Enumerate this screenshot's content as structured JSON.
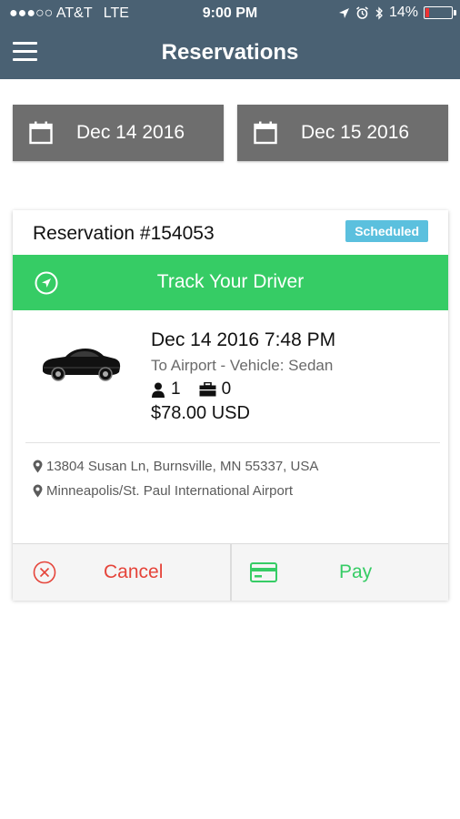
{
  "status_bar": {
    "signal": "●●●○○",
    "carrier": "AT&T",
    "network": "LTE",
    "time": "9:00 PM",
    "battery": "14%"
  },
  "navbar": {
    "title": "Reservations",
    "menu_icon": "hamburger-menu-icon"
  },
  "date_range": {
    "start": "Dec 14 2016",
    "end": "Dec 15 2016",
    "icon": "calendar-icon"
  },
  "reservation": {
    "title": "Reservation #154053",
    "status": "Scheduled",
    "track_label": "Track Your Driver",
    "datetime": "Dec 14 2016 7:48 PM",
    "route": "To Airport - Vehicle: Sedan",
    "passengers": "1",
    "luggage": "0",
    "price": "$78.00 USD",
    "pickup": "13804 Susan Ln, Burnsville, MN 55337, USA",
    "dropoff": "Minneapolis/St. Paul International Airport",
    "cancel_label": "Cancel",
    "pay_label": "Pay"
  },
  "colors": {
    "header": "#4a6173",
    "date_button": "#6e6e6e",
    "track_green": "#36cc65",
    "badge_blue": "#5bc0de",
    "cancel_red": "#e5443a"
  }
}
